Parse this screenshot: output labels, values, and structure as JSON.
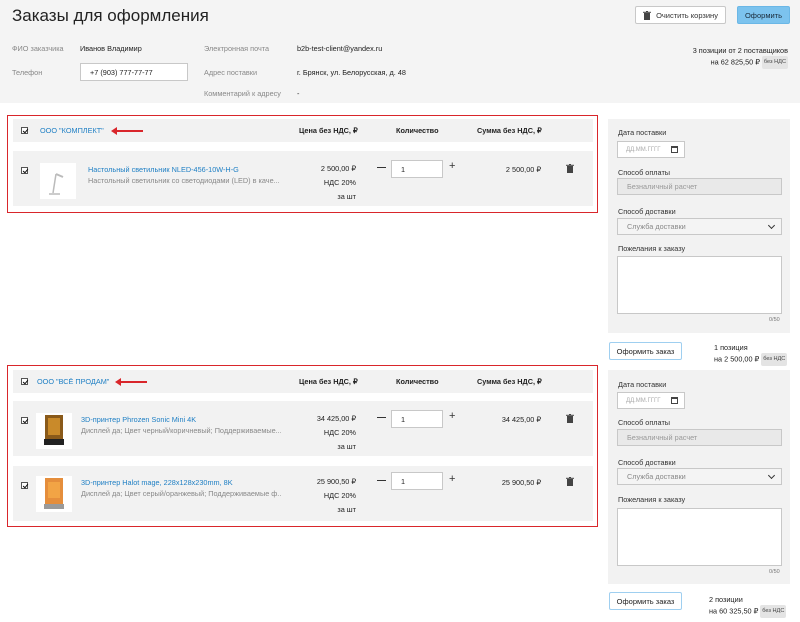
{
  "header": {
    "title": "Заказы для оформления",
    "clear_cart_label": "Очистить корзину",
    "checkout_label": "Оформить",
    "customer_label": "ФИО заказчика",
    "customer_value": "Иванов Владимир",
    "phone_label": "Телефон",
    "phone_value": "+7 (903) 777-77-77",
    "email_label": "Электронная почта",
    "email_value": "b2b-test-client@yandex.ru",
    "address_label": "Адрес поставки",
    "address_value": "г. Брянск, ул. Белорусская, д. 48",
    "comment_label": "Комментарий к адресу",
    "comment_value": "-",
    "summary_line1": "3 позиции от 2 поставщиков",
    "summary_line2": "на 62 825,50 ₽",
    "summary_badge": "без НДС"
  },
  "columns": {
    "price": "Цена без НДС, ₽",
    "qty": "Количество",
    "sum": "Сумма без НДС, ₽"
  },
  "groups": [
    {
      "supplier": "ООО \"КОМПЛЕКТ\"",
      "items": [
        {
          "name": "Настольный светильник NLED-456-10W-H-G",
          "desc": "Настольный светильник со светодиодами (LED) в каче...",
          "price": "2 500,00 ₽",
          "vat": "НДС 20%",
          "unit": "за шт",
          "qty": "1",
          "sum": "2 500,00 ₽"
        }
      ],
      "side": {
        "date_label": "Дата поставки",
        "date_placeholder": "ДД.ММ.ГГГГ",
        "payment_label": "Способ оплаты",
        "payment_value": "Безналичный расчет",
        "delivery_label": "Способ доставки",
        "delivery_value": "Служба доставки",
        "wishes_label": "Пожелания к заказу",
        "counter": "0/50"
      },
      "order_button": "Оформить заказ",
      "order_line1": "1 позиция",
      "order_line2": "на 2 500,00 ₽",
      "order_badge": "без НДС"
    },
    {
      "supplier": "ООО \"ВСЁ ПРОДАМ\"",
      "items": [
        {
          "name": "3D-принтер Phrozen Sonic Mini 4K",
          "desc": "Дисплей да; Цвет черный/коричневый; Поддерживаемые...",
          "price": "34 425,00 ₽",
          "vat": "НДС 20%",
          "unit": "за шт",
          "qty": "1",
          "sum": "34 425,00 ₽"
        },
        {
          "name": "3D-принтер Halot mage, 228x128x230mm, 8K",
          "desc": "Дисплей да; Цвет серый/оранжевый; Поддерживаемые ф...",
          "price": "25 900,50 ₽",
          "vat": "НДС 20%",
          "unit": "за шт",
          "qty": "1",
          "sum": "25 900,50 ₽"
        }
      ],
      "side": {
        "date_label": "Дата поставки",
        "date_placeholder": "ДД.ММ.ГГГГ",
        "payment_label": "Способ оплаты",
        "payment_value": "Безналичный расчет",
        "delivery_label": "Способ доставки",
        "delivery_value": "Служба доставки",
        "wishes_label": "Пожелания к заказу",
        "counter": "0/50"
      },
      "order_button": "Оформить заказ",
      "order_line1": "2 позиции",
      "order_line2": "на 60 325,50 ₽",
      "order_badge": "без НДС"
    }
  ],
  "colors": {
    "accent": "#1e7fc4",
    "checkout": "#7cc3ee",
    "highlight": "#d9262b"
  }
}
